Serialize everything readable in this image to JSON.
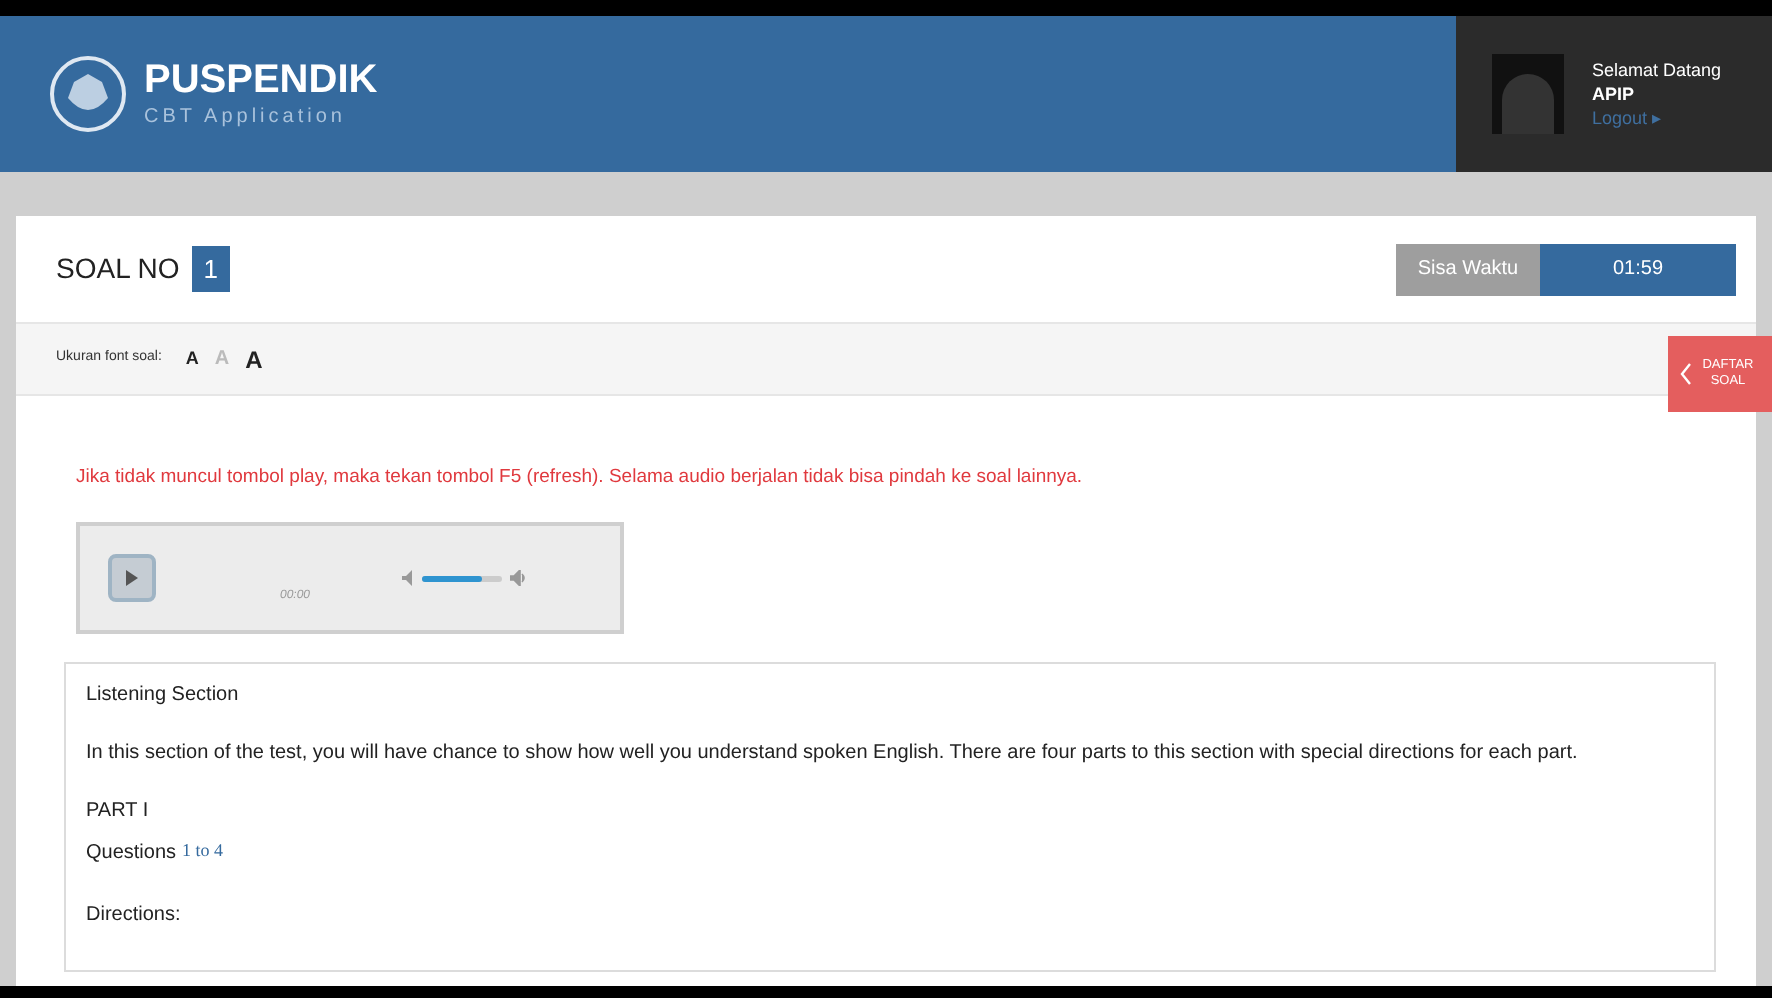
{
  "header": {
    "title": "PUSPENDIK",
    "subtitle": "CBT Application",
    "greeting": "Selamat Datang",
    "user": "APIP",
    "logout": "Logout ▸"
  },
  "question": {
    "label": "SOAL NO",
    "number": "1",
    "timer_label": "Sisa Waktu",
    "timer": "01:59"
  },
  "font_size": {
    "label": "Ukuran font soal:",
    "options": [
      {
        "label": "A",
        "selected": false
      },
      {
        "label": "A",
        "selected": true
      },
      {
        "label": "A",
        "selected": false
      }
    ]
  },
  "side_tab": {
    "label": "DAFTAR SOAL"
  },
  "notice": "Jika tidak muncul tombol play, maka tekan tombol F5 (refresh). Selama audio berjalan tidak bisa pindah ke soal lainnya.",
  "player": {
    "time": "00:00",
    "volume": {
      "level": 0.75
    }
  },
  "content": {
    "heading": "Listening Section",
    "paragraph": "In this section of the test, you will have chance to show how well you understand spoken English. There are four parts to this section with special directions for each part.",
    "part": "PART I",
    "questions_label": "Questions",
    "questions_range": "1 to 4",
    "directions": "Directions:"
  }
}
